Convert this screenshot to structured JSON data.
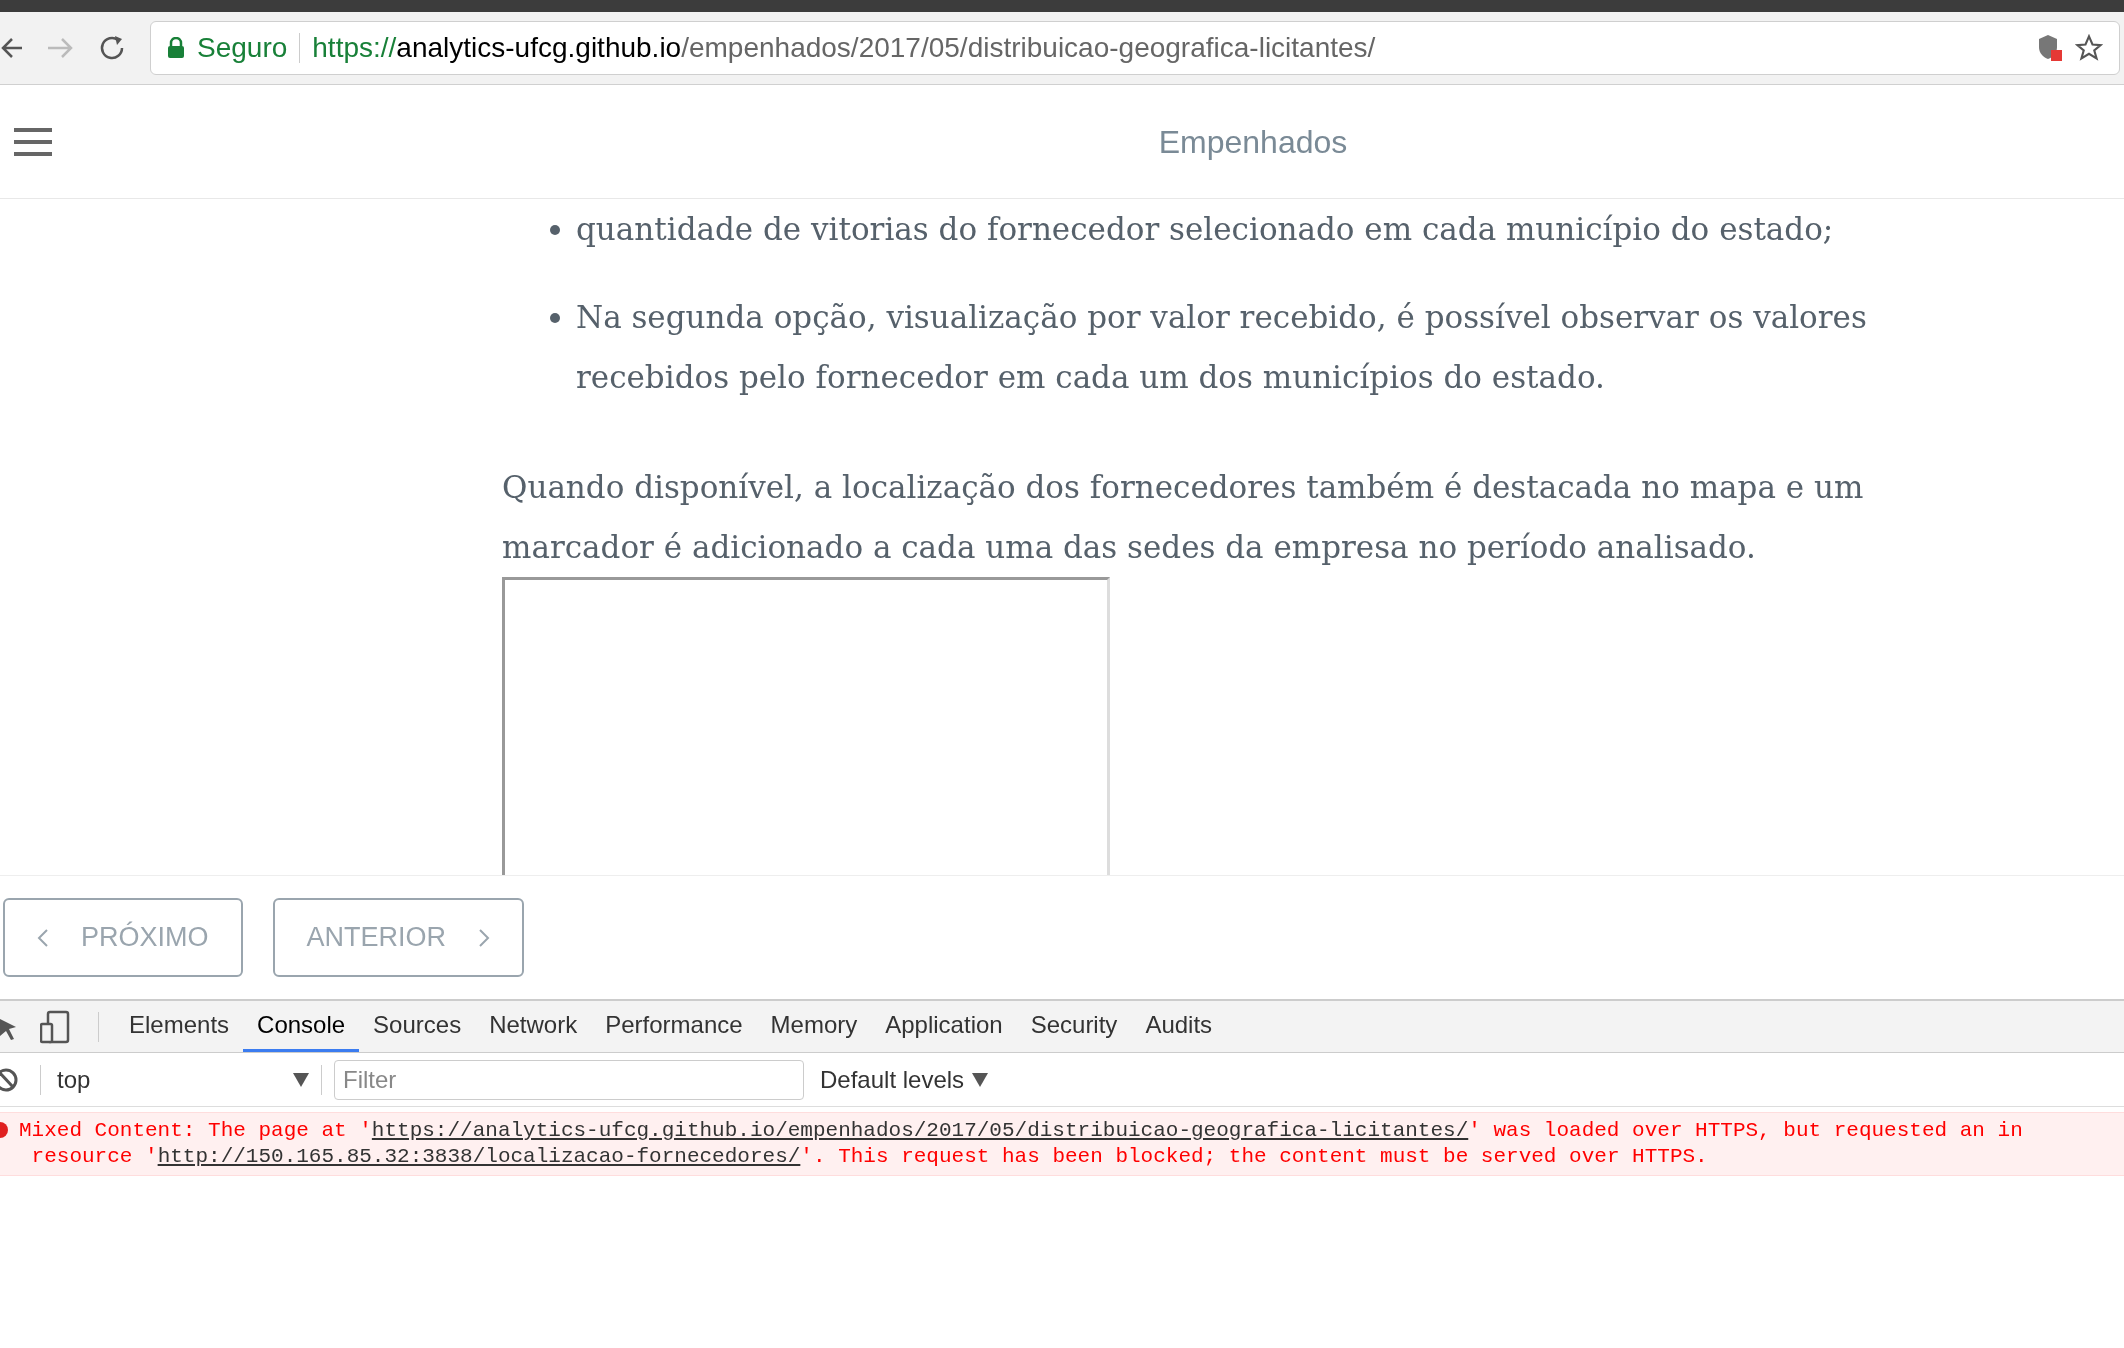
{
  "browser": {
    "secure_label": "Seguro",
    "url_scheme": "https://",
    "url_host": "analytics-ufcg.github.io",
    "url_path": "/empenhados/2017/05/distribuicao-geografica-licitantes/"
  },
  "header": {
    "title": "Empenhados"
  },
  "article": {
    "bullets": [
      "quantidade de vitorias do fornecedor selecionado em cada município do estado;",
      "Na segunda opção, visualização por valor recebido, é possível observar os valores recebidos pelo fornecedor em cada um dos municípios do estado."
    ],
    "paragraph": "Quando disponível, a localização dos fornecedores também é destacada no mapa e um marcador é adicionado a cada uma das sedes da empresa no período analisado."
  },
  "nav_buttons": [
    {
      "label": "PRÓXIMO",
      "kind": "prev"
    },
    {
      "label": "ANTERIOR",
      "kind": "next"
    }
  ],
  "devtools": {
    "tabs": [
      {
        "label": "Elements",
        "selected": false
      },
      {
        "label": "Console",
        "selected": true
      },
      {
        "label": "Sources",
        "selected": false
      },
      {
        "label": "Network",
        "selected": false
      },
      {
        "label": "Performance",
        "selected": false
      },
      {
        "label": "Memory",
        "selected": false
      },
      {
        "label": "Application",
        "selected": false
      },
      {
        "label": "Security",
        "selected": false
      },
      {
        "label": "Audits",
        "selected": false
      }
    ],
    "context": "top",
    "filter_placeholder": "Filter",
    "levels": "Default levels",
    "error_lines": [
      [
        {
          "kind": "text",
          "text": "Mixed Content: The page at '"
        },
        {
          "kind": "link",
          "text": "https://analytics-ufcg.github.io/empenhados/2017/05/distribuicao-geografica-licitantes/"
        },
        {
          "kind": "text",
          "text": "' was loaded over HTTPS, but requested an in"
        }
      ],
      [
        {
          "kind": "text",
          "text": " resource '"
        },
        {
          "kind": "link",
          "text": "http://150.165.85.32:3838/localizacao-fornecedores/"
        },
        {
          "kind": "text",
          "text": "'. This request has been blocked; the content must be served over HTTPS."
        }
      ]
    ]
  }
}
